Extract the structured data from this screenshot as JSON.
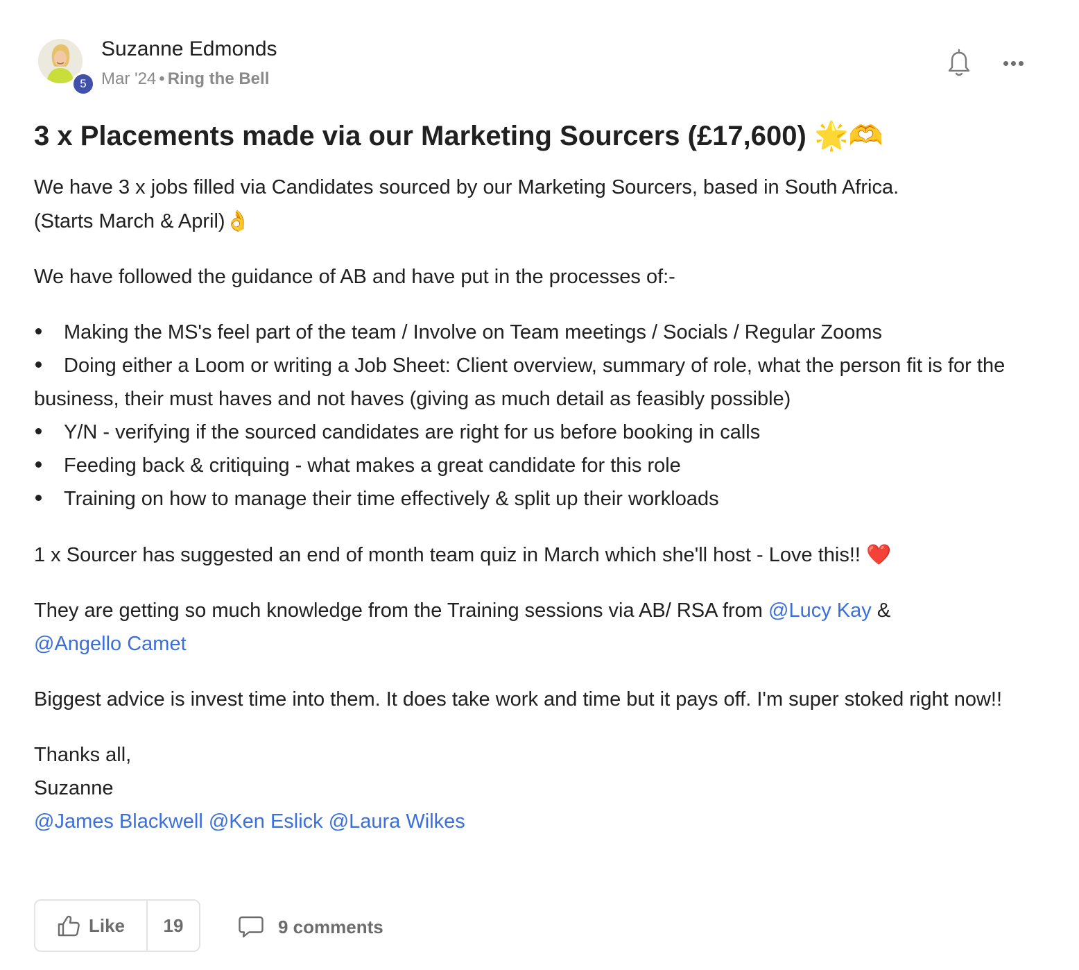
{
  "author": {
    "name": "Suzanne Edmonds",
    "level": "5",
    "date": "Mar '24",
    "separator": "•",
    "category": "Ring the Bell"
  },
  "post": {
    "title": "3 x Placements made via our Marketing Sourcers (£17,600)",
    "title_emoji": "🌟🫶",
    "para1_line1": "We have 3 x jobs filled via Candidates sourced by our Marketing Sourcers, based in South Africa.",
    "para1_line2": "(Starts March & April)",
    "para1_emoji": "👌",
    "para2": "We have followed the guidance of AB and have put in the processes of:-",
    "bullets": [
      "Making the MS's feel part of the team / Involve on Team meetings / Socials / Regular Zooms",
      "Doing either a Loom or writing a Job Sheet: Client overview, summary of role, what the person fit is for the business, their must haves and not haves (giving as much detail as feasibly possible)",
      "Y/N - verifying if the sourced candidates are right for us before booking in calls",
      "Feeding back & critiquing - what makes a great candidate for this role",
      "Training on how to manage their time effectively & split up their workloads"
    ],
    "para3": "1 x Sourcer has suggested an end of month team quiz in March which she'll host - Love this!!",
    "para3_emoji": "❤️",
    "para4_text": "They are getting so much knowledge from the Training sessions via AB/ RSA from",
    "para4_mention1": "@Lucy Kay",
    "para4_amp": "&",
    "para4_mention2": "@Angello Camet",
    "para5": "Biggest advice is invest time into them. It does take work and time but it pays off. I'm super stoked right now!!",
    "signoff_line1": "Thanks all,",
    "signoff_line2": "Suzanne",
    "mentions": [
      "@James Blackwell",
      "@Ken Eslick",
      "@Laura Wilkes"
    ]
  },
  "footer": {
    "like_label": "Like",
    "like_count": "19",
    "comments_label": "9 comments"
  },
  "icons": {
    "bell": "bell-icon",
    "more": "more-icon",
    "like": "thumbs-up-icon",
    "comment": "comment-icon"
  },
  "colors": {
    "mention": "#3b6fd9",
    "badge": "#4150a8",
    "muted": "#8a8a8a"
  }
}
